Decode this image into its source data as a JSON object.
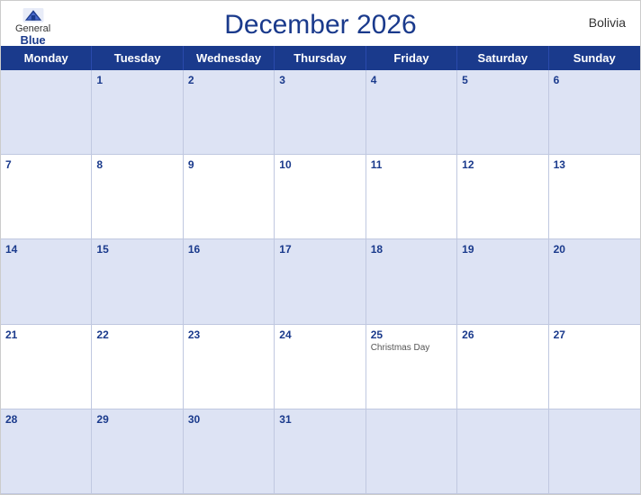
{
  "header": {
    "title": "December 2026",
    "country": "Bolivia",
    "logo": {
      "general": "General",
      "blue": "Blue"
    }
  },
  "dayHeaders": [
    "Monday",
    "Tuesday",
    "Wednesday",
    "Thursday",
    "Friday",
    "Saturday",
    "Sunday"
  ],
  "weeks": [
    [
      {
        "day": "",
        "holiday": ""
      },
      {
        "day": "1",
        "holiday": ""
      },
      {
        "day": "2",
        "holiday": ""
      },
      {
        "day": "3",
        "holiday": ""
      },
      {
        "day": "4",
        "holiday": ""
      },
      {
        "day": "5",
        "holiday": ""
      },
      {
        "day": "6",
        "holiday": ""
      }
    ],
    [
      {
        "day": "7",
        "holiday": ""
      },
      {
        "day": "8",
        "holiday": ""
      },
      {
        "day": "9",
        "holiday": ""
      },
      {
        "day": "10",
        "holiday": ""
      },
      {
        "day": "11",
        "holiday": ""
      },
      {
        "day": "12",
        "holiday": ""
      },
      {
        "day": "13",
        "holiday": ""
      }
    ],
    [
      {
        "day": "14",
        "holiday": ""
      },
      {
        "day": "15",
        "holiday": ""
      },
      {
        "day": "16",
        "holiday": ""
      },
      {
        "day": "17",
        "holiday": ""
      },
      {
        "day": "18",
        "holiday": ""
      },
      {
        "day": "19",
        "holiday": ""
      },
      {
        "day": "20",
        "holiday": ""
      }
    ],
    [
      {
        "day": "21",
        "holiday": ""
      },
      {
        "day": "22",
        "holiday": ""
      },
      {
        "day": "23",
        "holiday": ""
      },
      {
        "day": "24",
        "holiday": ""
      },
      {
        "day": "25",
        "holiday": "Christmas Day"
      },
      {
        "day": "26",
        "holiday": ""
      },
      {
        "day": "27",
        "holiday": ""
      }
    ],
    [
      {
        "day": "28",
        "holiday": ""
      },
      {
        "day": "29",
        "holiday": ""
      },
      {
        "day": "30",
        "holiday": ""
      },
      {
        "day": "31",
        "holiday": ""
      },
      {
        "day": "",
        "holiday": ""
      },
      {
        "day": "",
        "holiday": ""
      },
      {
        "day": "",
        "holiday": ""
      }
    ]
  ],
  "colors": {
    "headerBg": "#1a3a8c",
    "headerText": "#ffffff",
    "stripeBg": "#dde3f4",
    "plainBg": "#ffffff",
    "titleColor": "#1a3a8c",
    "dayNumColor": "#1a3a8c"
  }
}
